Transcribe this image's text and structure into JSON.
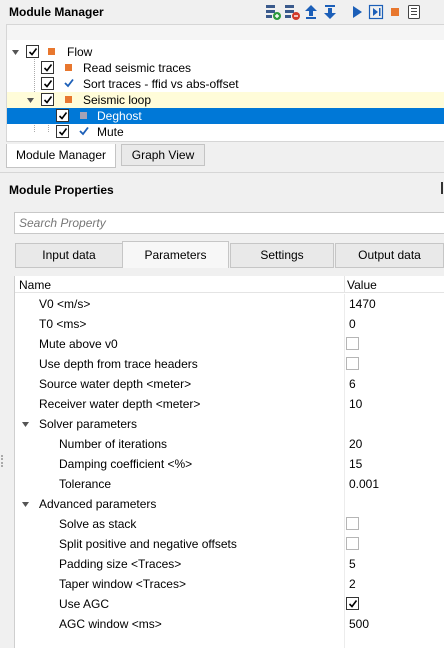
{
  "module_manager": {
    "title": "Module Manager",
    "toolbar": [
      {
        "icon": "add-module-icon"
      },
      {
        "icon": "remove-module-icon"
      },
      {
        "icon": "move-up-icon"
      },
      {
        "icon": "move-down-icon"
      },
      {
        "icon": "run-icon"
      },
      {
        "icon": "run-step-icon"
      },
      {
        "icon": "stop-icon"
      },
      {
        "icon": "log-icon"
      }
    ],
    "tree": [
      {
        "label": "Flow",
        "level": 0,
        "checked": true,
        "expanded": true,
        "marker": "square"
      },
      {
        "label": "Read seismic traces",
        "level": 1,
        "checked": true,
        "marker": "square"
      },
      {
        "label": "Sort traces -  ffid vs abs-offset",
        "level": 1,
        "checked": true,
        "marker": "check"
      },
      {
        "label": "Seismic loop",
        "level": 1,
        "checked": true,
        "expanded": true,
        "marker": "square",
        "highlight": "yellow"
      },
      {
        "label": "Deghost",
        "level": 2,
        "checked": true,
        "marker": "square",
        "highlight": "selected"
      },
      {
        "label": "Mute",
        "level": 2,
        "checked": true,
        "marker": "check"
      }
    ],
    "tabs": [
      "Module Manager",
      "Graph View"
    ],
    "active_tab": "Module Manager"
  },
  "module_properties": {
    "title": "Module Properties",
    "search_placeholder": "Search Property",
    "tabs": [
      "Input data",
      "Parameters",
      "Settings",
      "Output data"
    ],
    "active_tab": "Parameters",
    "columns": {
      "name": "Name",
      "value": "Value"
    },
    "rows": [
      {
        "name": "V0 <m/s>",
        "value": "1470"
      },
      {
        "name": "T0 <ms>",
        "value": "0"
      },
      {
        "name": "Mute above v0",
        "checkbox": false
      },
      {
        "name": "Use depth from trace headers",
        "checkbox": false
      },
      {
        "name": "Source water depth <meter>",
        "value": "6"
      },
      {
        "name": "Receiver water depth <meter>",
        "value": "10"
      },
      {
        "name": "Solver parameters",
        "group": true
      },
      {
        "name": "Number of iterations",
        "value": "20",
        "indent": true
      },
      {
        "name": "Damping coefficient <%>",
        "value": "15",
        "indent": true
      },
      {
        "name": "Tolerance",
        "value": "0.001",
        "indent": true
      },
      {
        "name": "Advanced parameters",
        "group": true
      },
      {
        "name": "Solve as stack",
        "checkbox": false,
        "indent": true
      },
      {
        "name": "Split positive and negative offsets",
        "checkbox": false,
        "indent": true
      },
      {
        "name": "Padding size <Traces>",
        "value": "5",
        "indent": true
      },
      {
        "name": "Taper window <Traces>",
        "value": "2",
        "indent": true
      },
      {
        "name": "Use AGC",
        "checkbox": true,
        "indent": true
      },
      {
        "name": "AGC window <ms>",
        "value": "500",
        "indent": true
      }
    ]
  },
  "colors": {
    "selection": "#0078d7",
    "loop_highlight": "#fffcd9",
    "module_marker": "#e8772e",
    "check_blue": "#1c5fb8"
  }
}
